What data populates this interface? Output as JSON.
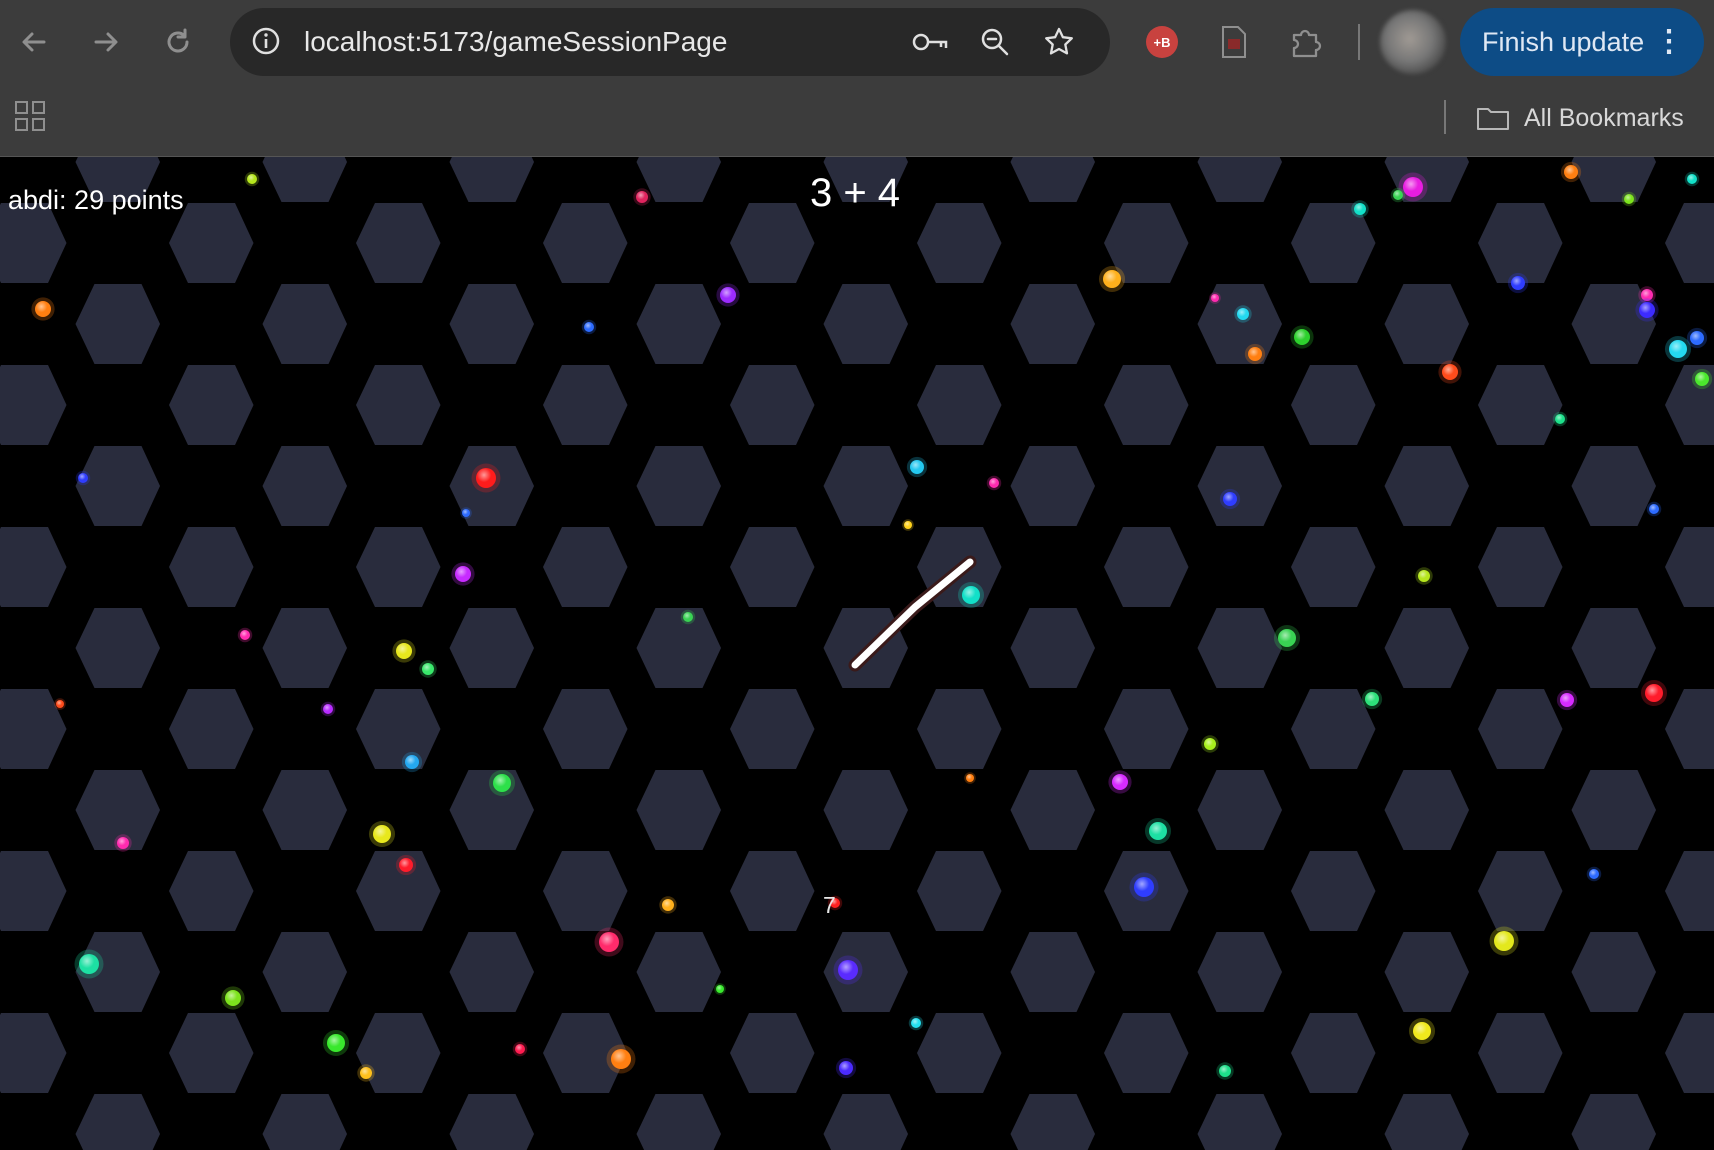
{
  "browser": {
    "url": "localhost:5173/gameSessionPage",
    "finish_update_label": "Finish update",
    "all_bookmarks_label": "All Bookmarks",
    "extension_badge": "+B"
  },
  "game": {
    "score_text": "abdi: 29 points",
    "problem": "3 + 4",
    "food_label": "7"
  },
  "colors": {
    "chrome_bg": "#3c3c3c",
    "omnibox_bg": "#282828",
    "accent_button": "#0d4c86",
    "hex_tile": "#292c3d",
    "background": "#000000"
  }
}
